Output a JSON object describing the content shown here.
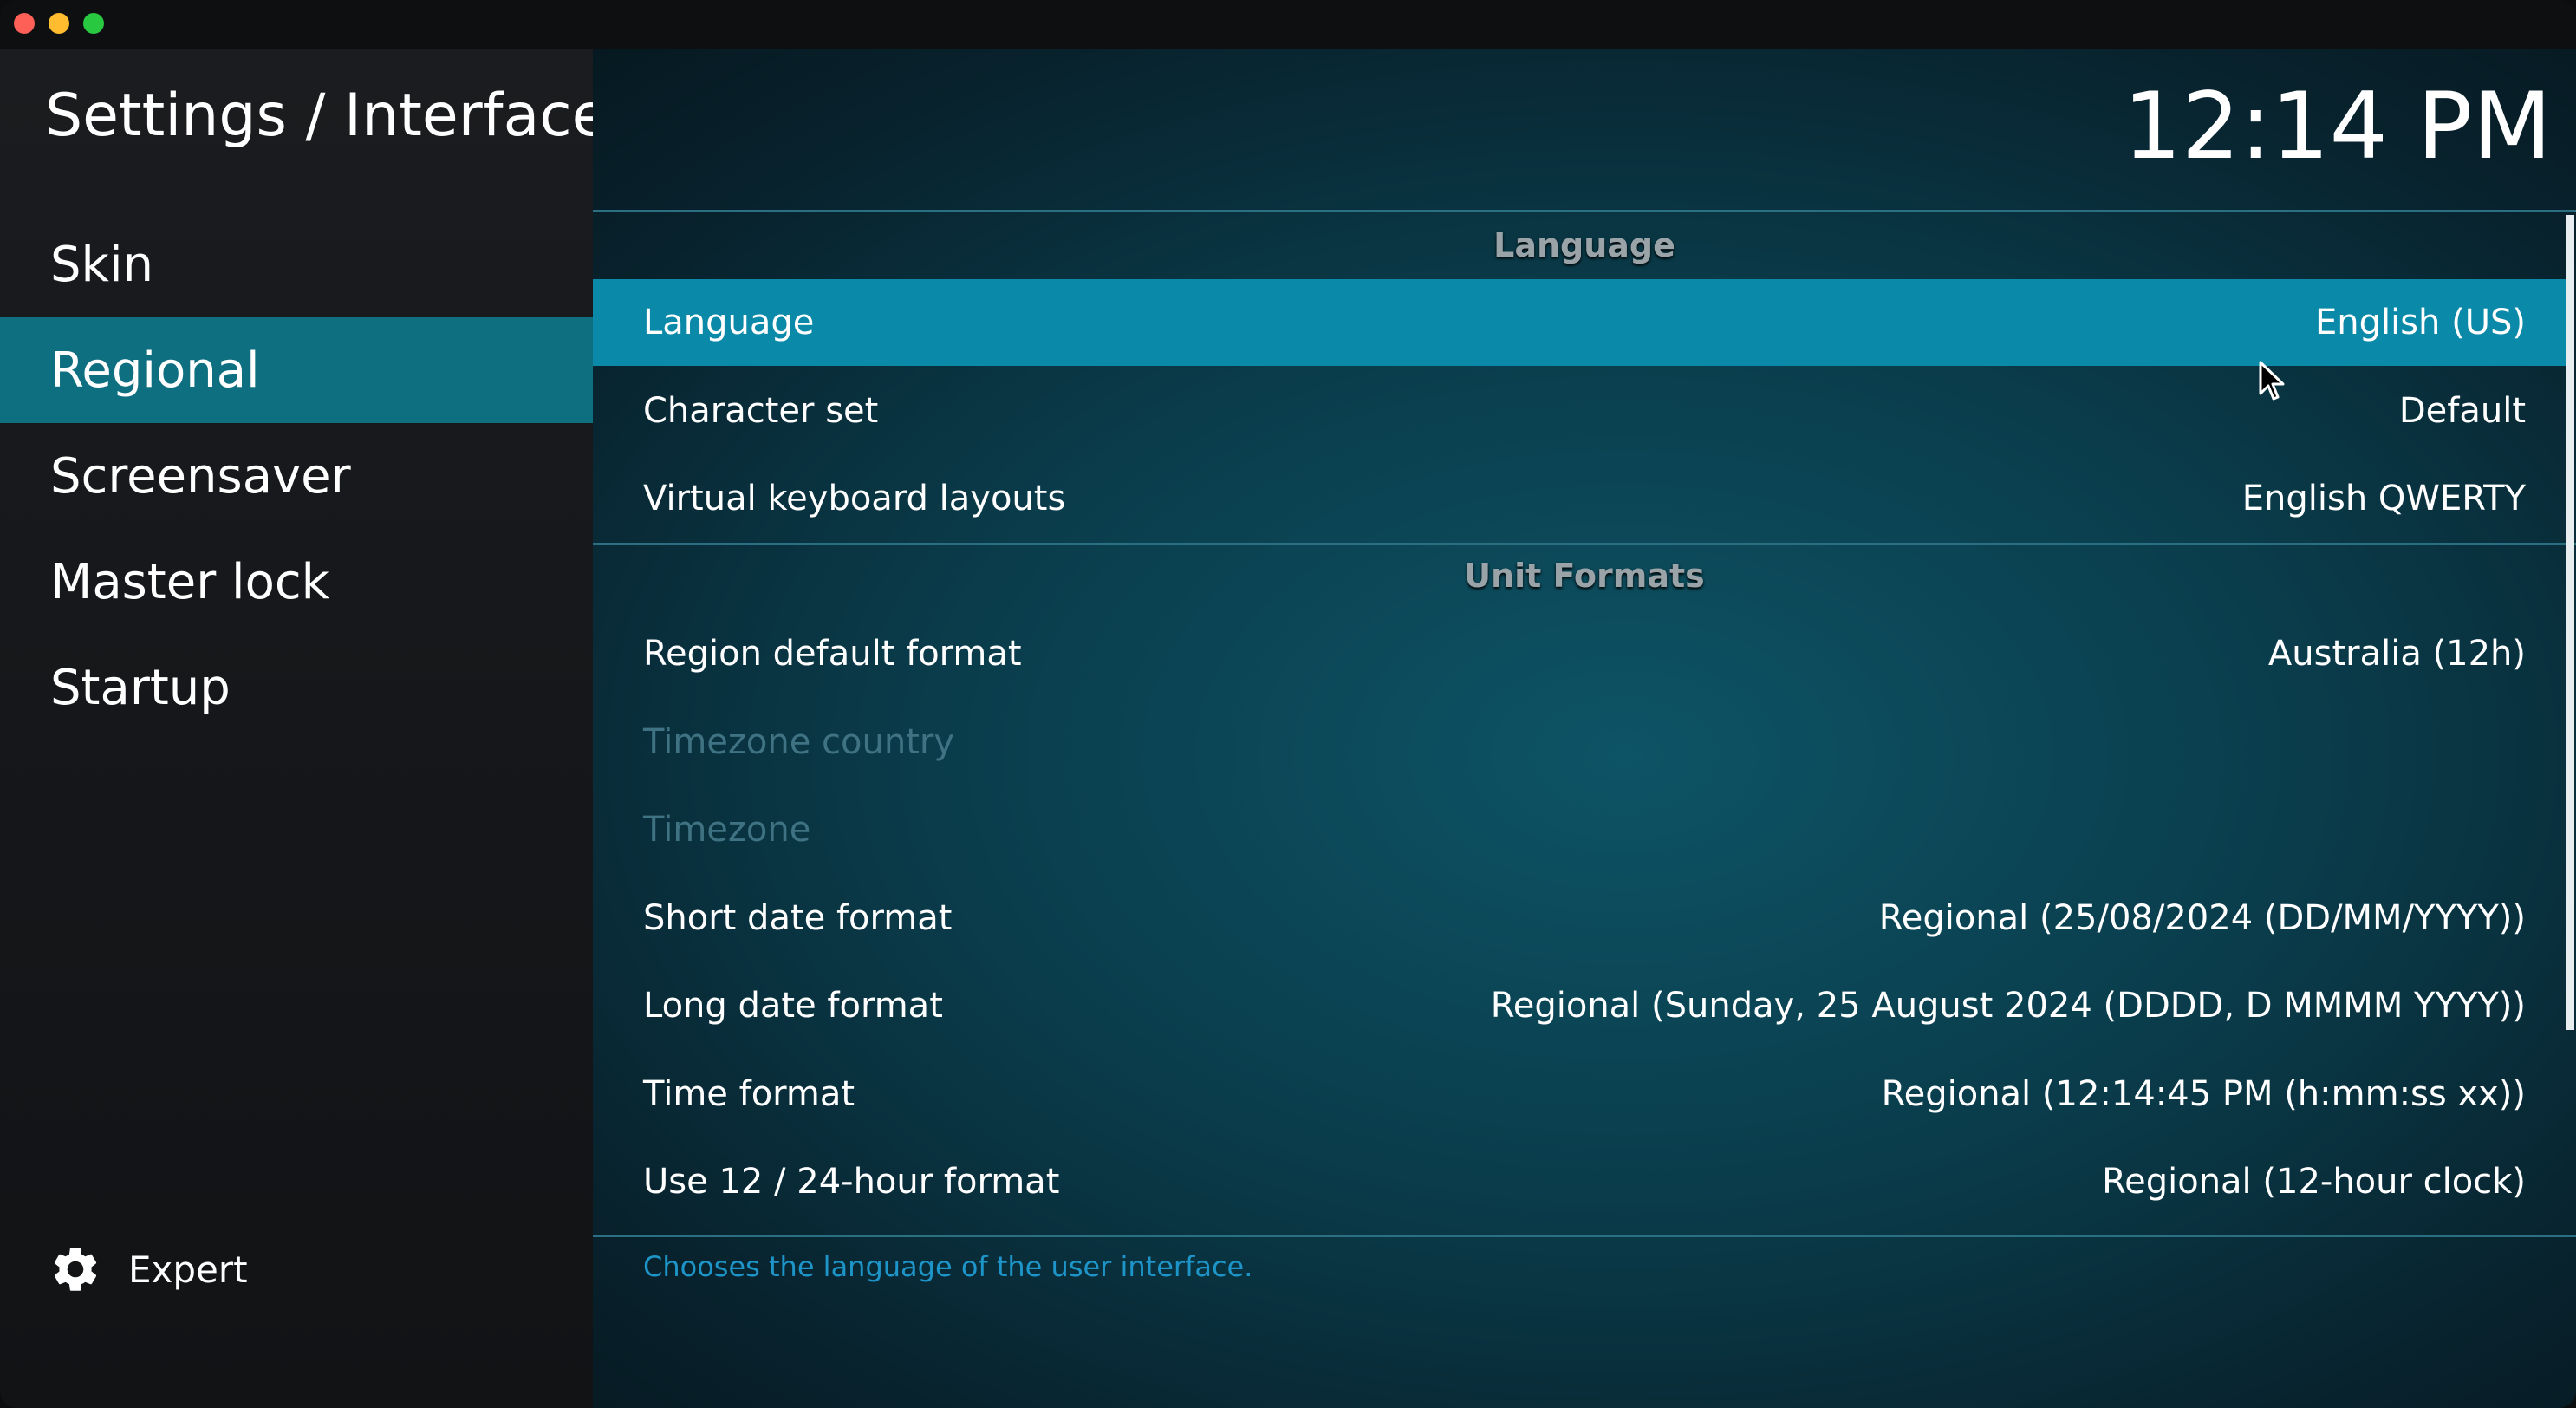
{
  "window": {
    "breadcrumb": "Settings / Interface",
    "clock": "12:14 PM"
  },
  "sidebar": {
    "items": [
      {
        "label": "Skin",
        "active": false
      },
      {
        "label": "Regional",
        "active": true
      },
      {
        "label": "Screensaver",
        "active": false
      },
      {
        "label": "Master lock",
        "active": false
      },
      {
        "label": "Startup",
        "active": false
      }
    ],
    "expert_label": "Expert"
  },
  "sections": {
    "language": {
      "header": "Language",
      "rows": [
        {
          "label": "Language",
          "value": "English (US)"
        },
        {
          "label": "Character set",
          "value": "Default"
        },
        {
          "label": "Virtual keyboard layouts",
          "value": "English QWERTY"
        }
      ]
    },
    "unit_formats": {
      "header": "Unit Formats",
      "rows": [
        {
          "label": "Region default format",
          "value": "Australia (12h)"
        },
        {
          "label": "Timezone country",
          "value": ""
        },
        {
          "label": "Timezone",
          "value": ""
        },
        {
          "label": "Short date format",
          "value": "Regional (25/08/2024 (DD/MM/YYYY))"
        },
        {
          "label": "Long date format",
          "value": "Regional (Sunday, 25 August 2024 (DDDD, D MMMM YYYY))"
        },
        {
          "label": "Time format",
          "value": "Regional (12:14:45 PM (h:mm:ss xx))"
        },
        {
          "label": "Use 12 / 24-hour format",
          "value": "Regional (12-hour clock)"
        }
      ]
    }
  },
  "hint": "Chooses the language of the user interface.",
  "colors": {
    "accent": "#0a89a8",
    "sidebar_active": "#0e6f80",
    "hint_text": "#1d95c8",
    "disabled_text": "#3f7282"
  },
  "icons": {
    "expert": "gear-icon",
    "pointer": "mouse-pointer-icon"
  }
}
